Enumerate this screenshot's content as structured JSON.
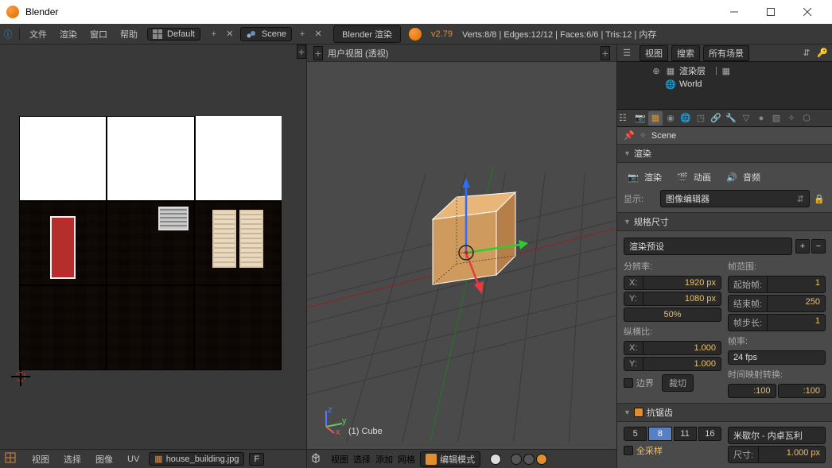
{
  "titlebar": {
    "title": "Blender"
  },
  "topmenu": {
    "file": "文件",
    "render": "渲染",
    "window": "窗口",
    "help": "帮助",
    "layout": "Default",
    "scene": "Scene",
    "engine": "Blender 渲染",
    "version": "v2.79",
    "stats": "Verts:8/8 | Edges:12/12 | Faces:6/6 | Tris:12 | 内存"
  },
  "uv": {
    "view": "视图",
    "select": "选择",
    "image": "图像",
    "uvs": "UV",
    "image_name": "house_building.jpg",
    "pin": "F"
  },
  "view3d": {
    "header": "用户视图  (透视)",
    "object": "(1) Cube",
    "view": "视图",
    "select": "选择",
    "add": "添加",
    "mesh": "网格",
    "mode": "编辑模式"
  },
  "outliner": {
    "view": "视图",
    "search": "搜索",
    "all": "所有场景",
    "renderlayers": "渲染层",
    "world": "World"
  },
  "props": {
    "context": "Scene",
    "render_panel": "渲染",
    "render": "渲染",
    "anim": "动画",
    "audio": "音频",
    "display": "显示:",
    "display_val": "图像编辑器",
    "dim_panel": "规格尺寸",
    "preset": "渲染预设",
    "res_label": "分辨率:",
    "x": "X:",
    "y": "Y:",
    "res_x": "1920 px",
    "res_y": "1080 px",
    "res_pct": "50%",
    "frange": "帧范围:",
    "fstart": "起始帧:",
    "fend": "结束帧:",
    "fstep": "帧步长:",
    "fstart_v": "1",
    "fend_v": "250",
    "fstep_v": "1",
    "aspect": "纵横比:",
    "asp_x": "1.000",
    "asp_y": "1.000",
    "rate": "帧率:",
    "rate_v": "24 fps",
    "remap": "时间映射转换:",
    "old": ":100",
    "new": ":100",
    "border": "边界",
    "crop": "裁切",
    "aa_panel": "抗锯齿",
    "aa5": "5",
    "aa8": "8",
    "aa11": "11",
    "aa16": "16",
    "aa_filter": "米歇尔 - 内卓瓦利",
    "full": "全采样",
    "size_l": "尺寸:",
    "size_v": "1.000 px"
  }
}
